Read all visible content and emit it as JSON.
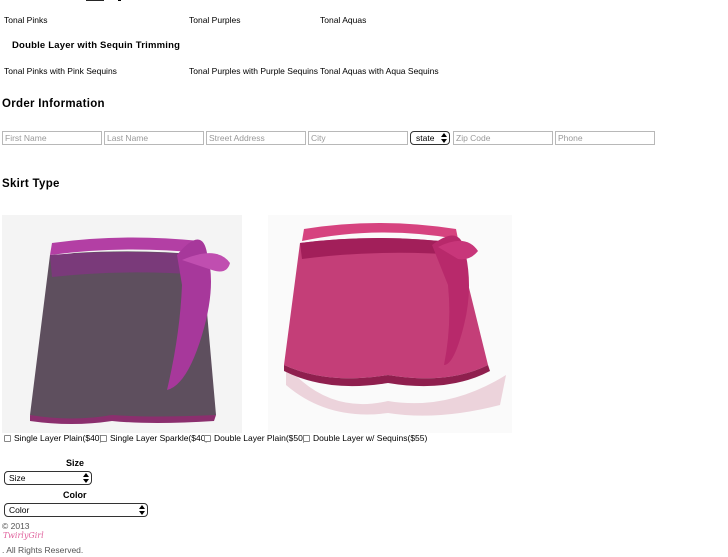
{
  "colors_row1": {
    "c1": "Tonal Pinks",
    "c2": "Tonal Purples",
    "c3": "Tonal Aquas"
  },
  "double_layer_heading": "Double Layer with Sequin Trimming",
  "colors_row2": {
    "c1": "Tonal Pinks with Pink Sequins",
    "c2": "Tonal Purples with Purple Sequins",
    "c3": "Tonal Aquas with Aqua Sequins"
  },
  "order": {
    "heading": "Order Information",
    "first_name_placeholder": "First Name",
    "last_name_placeholder": "Last Name",
    "street_placeholder": "Street Address",
    "city_placeholder": "City",
    "state_value": "state",
    "zip_placeholder": "Zip Code",
    "phone_placeholder": "Phone"
  },
  "skirt": {
    "heading": "Skirt Type",
    "options": [
      "Single Layer Plain($40)",
      "Single Layer Sparkle($40)",
      "Double Layer Plain($50)",
      "Double Layer w/ Sequins($55)"
    ]
  },
  "size": {
    "label": "Size",
    "value": "Size"
  },
  "color": {
    "label": "Color",
    "value": "Color"
  },
  "footer": {
    "copyright": "© 2013",
    "logo": "TwirlyGirl",
    "rights": ". All Rights Reserved."
  }
}
